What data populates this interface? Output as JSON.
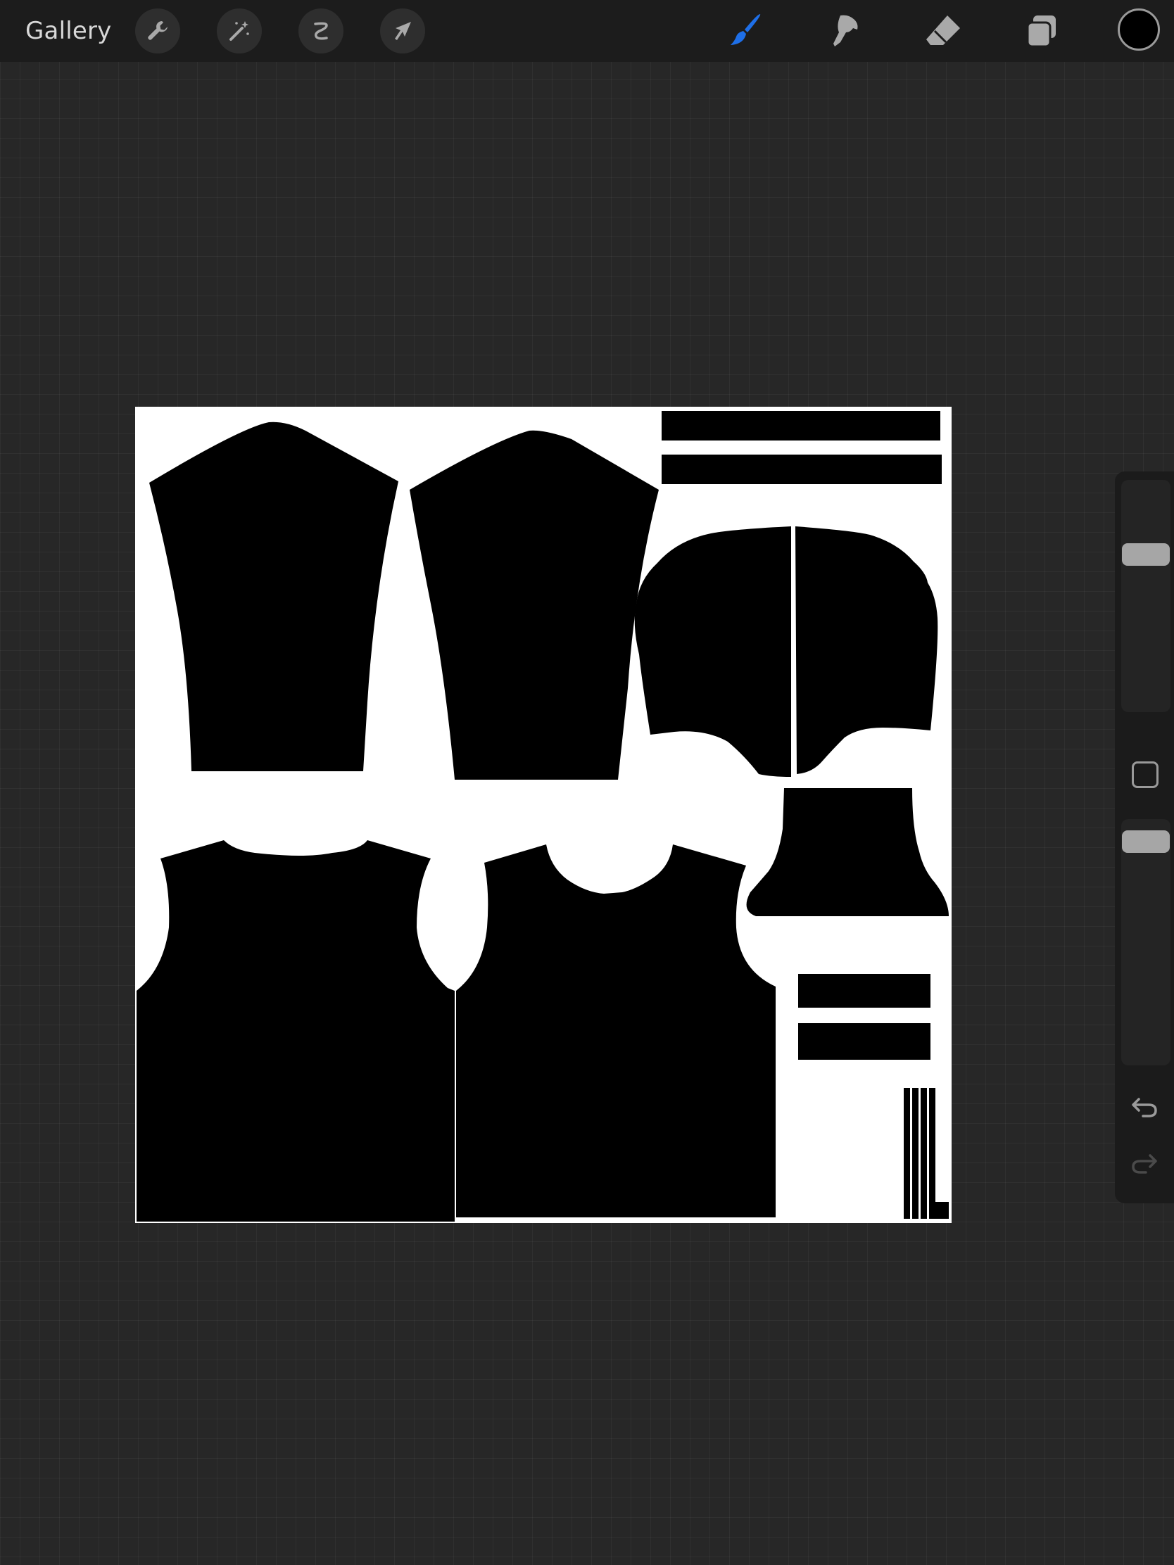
{
  "toolbar": {
    "gallery_label": "Gallery",
    "left_tools": [
      "wrench-icon",
      "magic-wand-icon",
      "selection-icon",
      "transform-arrow-icon"
    ],
    "right_tools": [
      "paintbrush-icon",
      "smudge-icon",
      "eraser-icon",
      "layers-icon"
    ],
    "active_tool": "paintbrush-icon",
    "active_color": "#1e6fe8",
    "current_color": "#000000"
  },
  "sidebar": {
    "brush_size": "brush-size-slider",
    "modify_button": "modify-square-icon",
    "opacity": "opacity-slider",
    "undo": "undo-icon",
    "redo": "redo-icon"
  }
}
